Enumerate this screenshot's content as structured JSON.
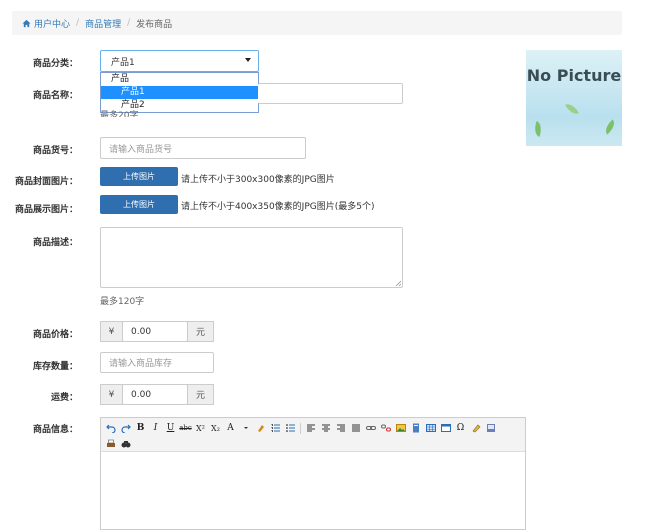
{
  "breadcrumb": {
    "home": "用户中心",
    "section": "商品管理",
    "current": "发布商品"
  },
  "form": {
    "category": {
      "label": "商品分类：",
      "selected": "产品1",
      "options": [
        "产品",
        "产品1",
        "产品2"
      ]
    },
    "name": {
      "label": "商品名称：",
      "hint": "最多20字"
    },
    "sku": {
      "label": "商品货号：",
      "placeholder": "请输入商品货号"
    },
    "cover_image": {
      "label": "商品封面图片：",
      "button": "上传图片",
      "hint": "请上传不小于300x300像素的JPG图片"
    },
    "display_images": {
      "label": "商品展示图片：",
      "button": "上传图片",
      "hint": "请上传不小于400x350像素的JPG图片(最多5个)"
    },
    "description": {
      "label": "商品描述：",
      "hint": "最多120字"
    },
    "price": {
      "label": "商品价格：",
      "prefix": "¥",
      "value": "0.00",
      "suffix": "元"
    },
    "stock": {
      "label": "库存数量：",
      "placeholder": "请输入商品库存"
    },
    "shipping": {
      "label": "运费：",
      "prefix": "¥",
      "value": "0.00",
      "suffix": "元"
    },
    "info": {
      "label": "商品信息："
    }
  },
  "preview": {
    "text": "No Picture"
  },
  "editor": {
    "buttons": [
      "undo",
      "redo",
      "bold",
      "italic",
      "underline",
      "strikethrough",
      "superscript",
      "subscript",
      "font-color",
      "highlight",
      "ordered-list",
      "unordered-list",
      "align-left",
      "align-center",
      "align-right",
      "align-justify",
      "link",
      "unlink",
      "image",
      "insert-file",
      "table",
      "template",
      "special-char",
      "eraser",
      "preview",
      "print",
      "find"
    ],
    "bold": "B",
    "italic": "I",
    "underline": "U",
    "strike": "abc",
    "sup": "X²",
    "sub": "X₂",
    "fontcolor": "A",
    "omega": "Ω"
  }
}
